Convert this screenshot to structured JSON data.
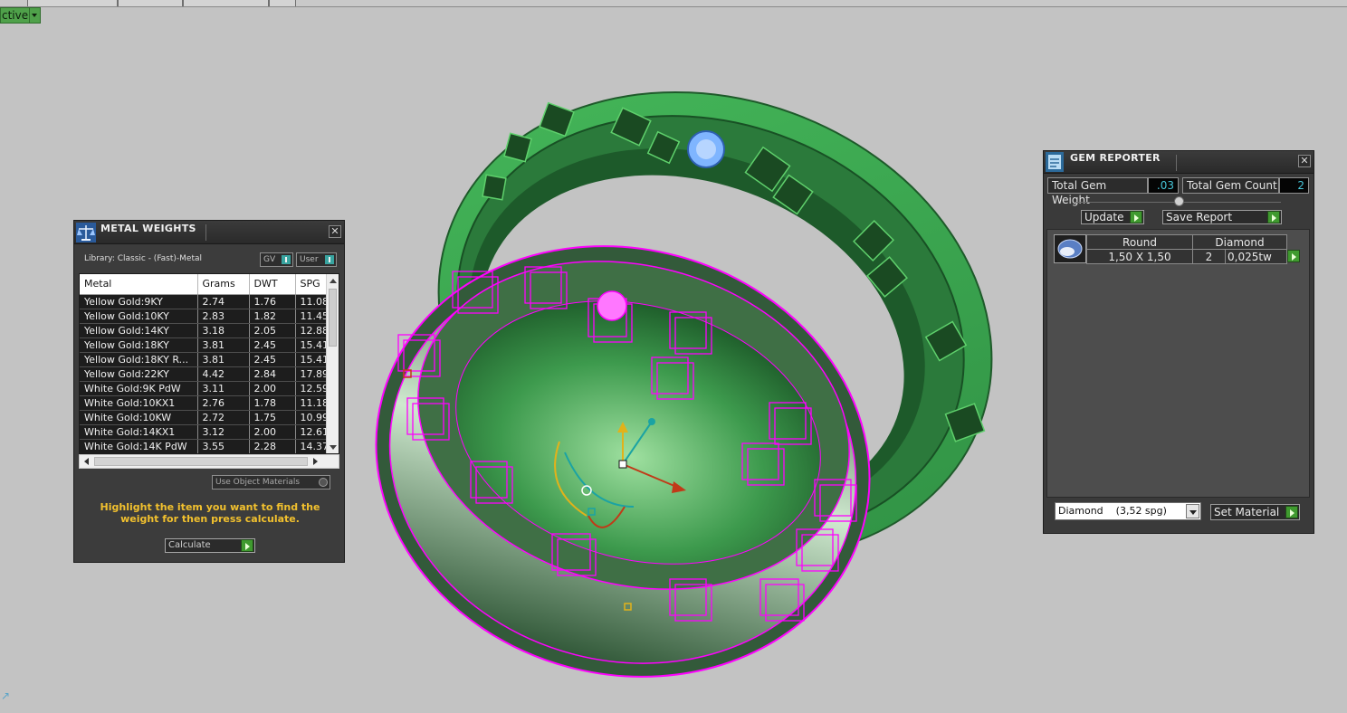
{
  "viewport": {
    "mode_label": "ctive"
  },
  "metal_weights": {
    "title": "METAL WEIGHTS",
    "library": "Library: Classic - (Fast)-Metal",
    "gv_label": "GV",
    "user_label": "User",
    "columns": [
      "Metal",
      "Grams",
      "DWT",
      "SPG"
    ],
    "rows": [
      [
        "Yellow Gold:9KY",
        "2.74",
        "1.76",
        "11.08"
      ],
      [
        "Yellow Gold:10KY",
        "2.83",
        "1.82",
        "11.45"
      ],
      [
        "Yellow Gold:14KY",
        "3.18",
        "2.05",
        "12.88"
      ],
      [
        "Yellow Gold:18KY",
        "3.81",
        "2.45",
        "15.41"
      ],
      [
        "Yellow Gold:18KY R...",
        "3.81",
        "2.45",
        "15.41"
      ],
      [
        "Yellow Gold:22KY",
        "4.42",
        "2.84",
        "17.89"
      ],
      [
        "White Gold:9K PdW",
        "3.11",
        "2.00",
        "12.59"
      ],
      [
        "White Gold:10KX1",
        "2.76",
        "1.78",
        "11.18"
      ],
      [
        "White Gold:10KW",
        "2.72",
        "1.75",
        "10.99"
      ],
      [
        "White Gold:14KX1",
        "3.12",
        "2.00",
        "12.61"
      ],
      [
        "White Gold:14K PdW",
        "3.55",
        "2.28",
        "14.37"
      ]
    ],
    "use_object_materials": "Use Object Materials",
    "hint": "Highlight the item you want to find the weight for then press calculate.",
    "calculate": "Calculate"
  },
  "gem_reporter": {
    "title": "GEM REPORTER",
    "total_gem_weight_label": "Total Gem Weight",
    "total_gem_weight": ".03",
    "total_gem_count_label": "Total Gem Count",
    "total_gem_count": "2",
    "update": "Update",
    "save_report": "Save Report",
    "gem_row": {
      "shape": "Round",
      "material": "Diamond",
      "size": "1,50 X 1,50",
      "count": "2",
      "weight": "0,025tw"
    },
    "material_select": "Diamond    (3,52 spg)",
    "set_material": "Set Material"
  },
  "colors": {
    "background": "#c3c3c3",
    "ring_green": "#3fae52",
    "wireframe_magenta": "#ff00ff",
    "hint_yellow": "#f2c12e",
    "value_cyan": "#46c5d8"
  }
}
